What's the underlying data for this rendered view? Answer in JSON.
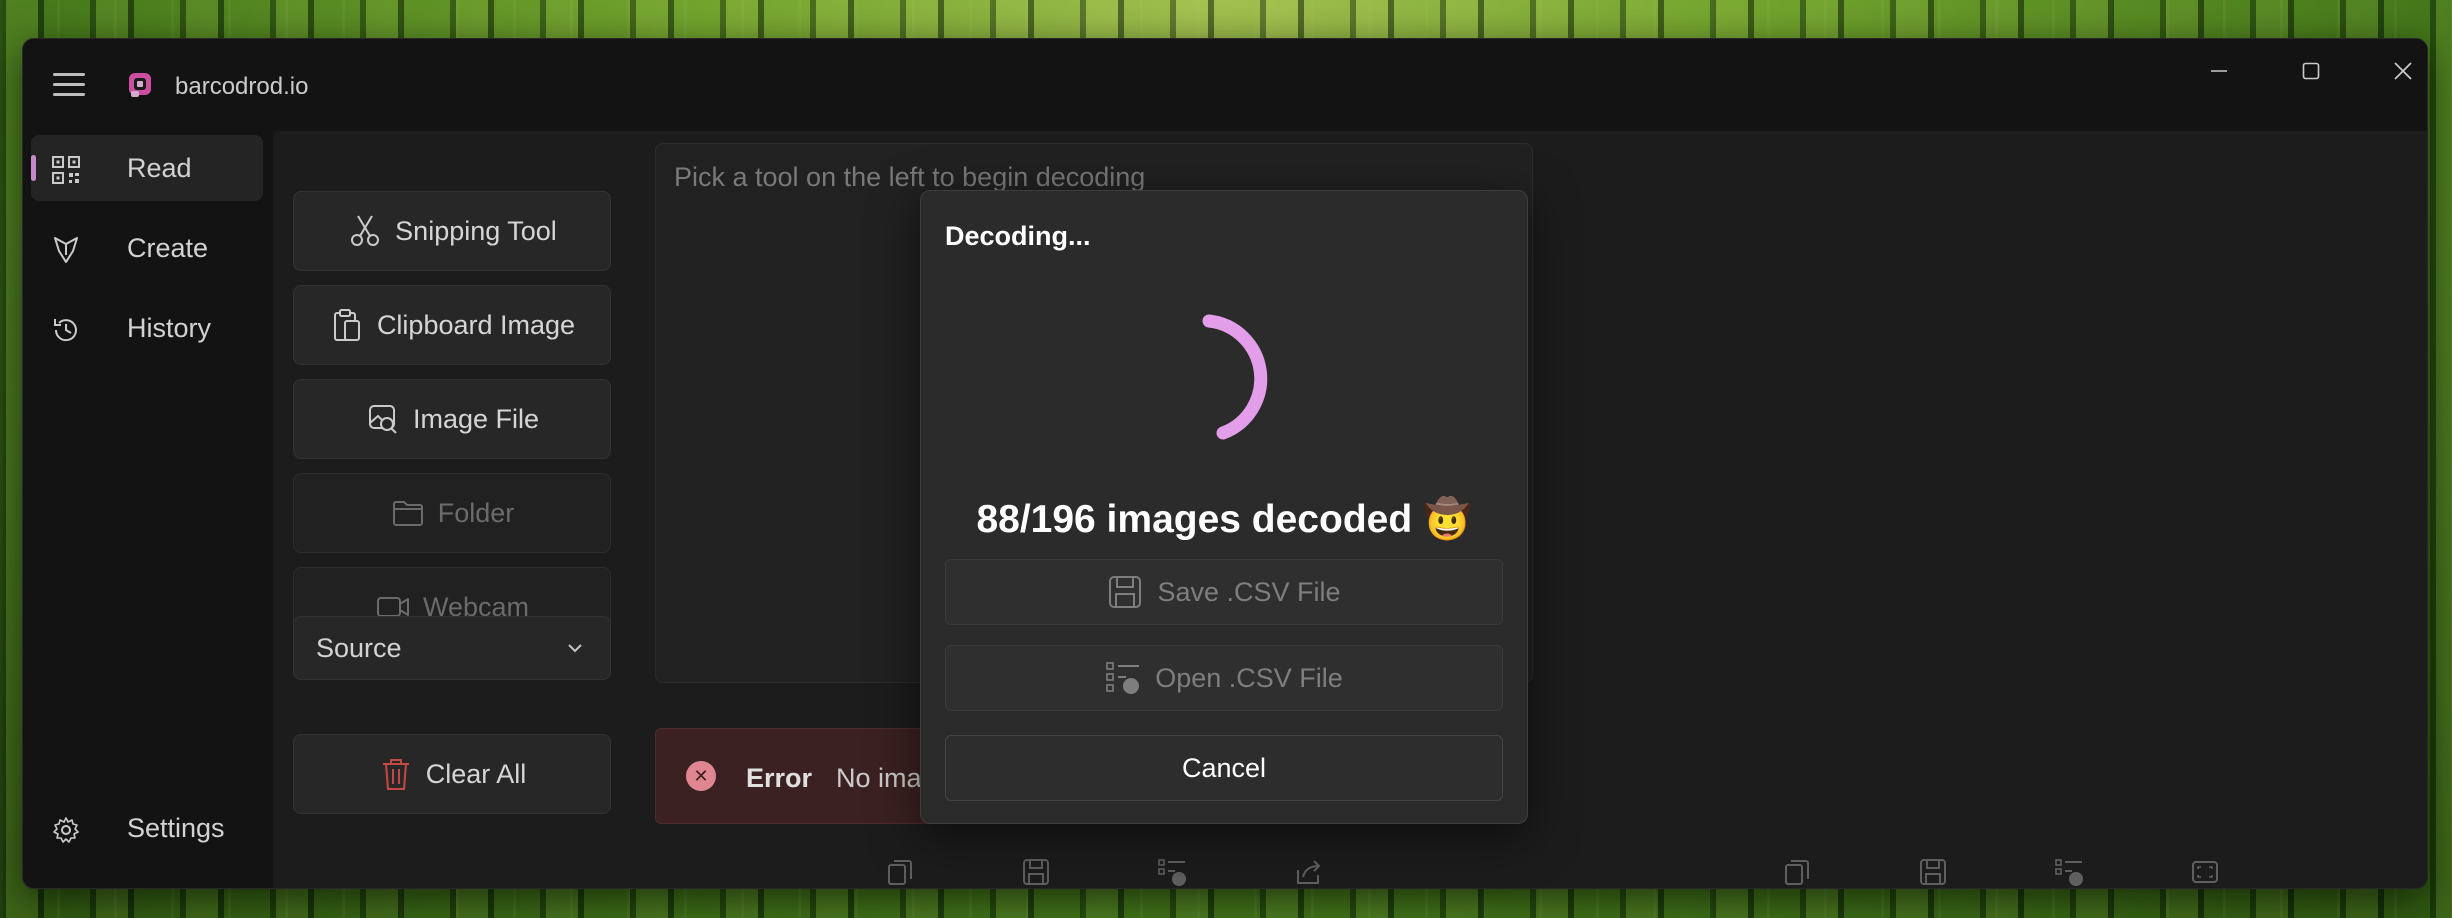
{
  "app": {
    "title": "barcodrod.io"
  },
  "sidebar": {
    "items": [
      {
        "label": "Read",
        "icon": "qr-code-icon"
      },
      {
        "label": "Create",
        "icon": "create-icon"
      },
      {
        "label": "History",
        "icon": "history-icon"
      }
    ],
    "settings_label": "Settings"
  },
  "tools": {
    "snipping": "Snipping Tool",
    "clipboard": "Clipboard Image",
    "image_file": "Image File",
    "folder": "Folder",
    "webcam": "Webcam",
    "source": "Source",
    "clear_all": "Clear All"
  },
  "output": {
    "placeholder": "Pick a tool on the left to begin decoding"
  },
  "error": {
    "title": "Error",
    "message": "No images found"
  },
  "dialog": {
    "title": "Decoding...",
    "progress": "88/196 images decoded 🤠",
    "decoded": 88,
    "total": 196,
    "save_csv": "Save .CSV File",
    "open_csv": "Open .CSV File",
    "cancel": "Cancel"
  },
  "colors": {
    "accent": "#e29ee8",
    "error_bg": "#442626",
    "error_icon": "#ff99a4"
  }
}
